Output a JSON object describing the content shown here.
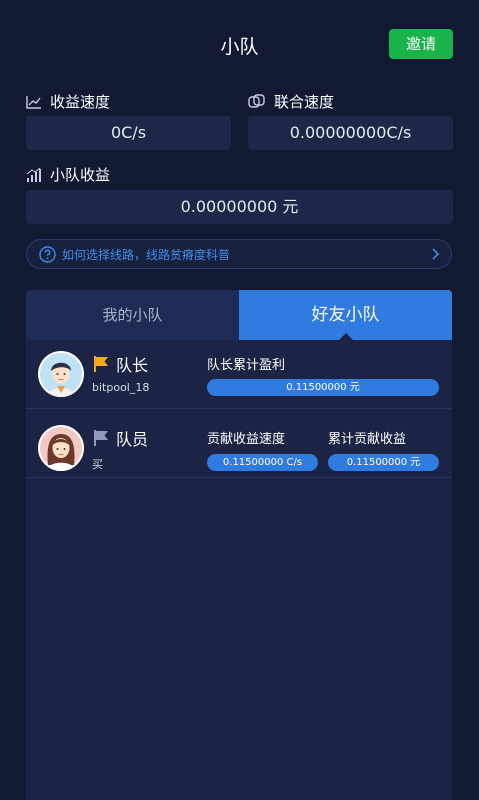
{
  "header": {
    "title": "小队",
    "invite_label": "邀请"
  },
  "stats": {
    "earn_speed": {
      "label": "收益速度",
      "value": "0C/s"
    },
    "union_speed": {
      "label": "联合速度",
      "value": "0.00000000C/s"
    },
    "team_earnings": {
      "label": "小队收益",
      "value": "0.00000000 元"
    }
  },
  "notice": {
    "text": "如何选择线路，线路贫瘠度科普"
  },
  "tabs": [
    {
      "label": "我的小队",
      "active": false
    },
    {
      "label": "好友小队",
      "active": true
    }
  ],
  "members": [
    {
      "role": "队长",
      "username": "bitpool_18",
      "flag_color": "#f5a623",
      "columns": [
        {
          "label": "队长累计盈利",
          "value": "0.11500000 元"
        }
      ]
    },
    {
      "role": "队员",
      "username": "买",
      "flag_color": "#8f9ab8",
      "columns": [
        {
          "label": "贡献收益速度",
          "value": "0.11500000 C/s"
        },
        {
          "label": "累计贡献收益",
          "value": "0.11500000 元"
        }
      ]
    }
  ],
  "colors": {
    "background": "#121a33",
    "accent": "#2f7be0",
    "invite": "#18b34b",
    "link": "#3f8ee6"
  }
}
